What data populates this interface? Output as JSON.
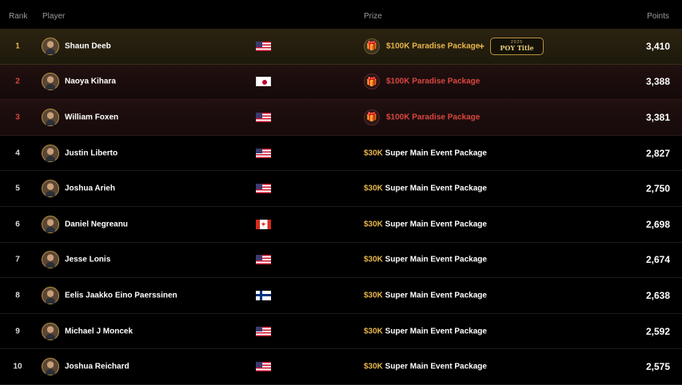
{
  "header": {
    "rank": "Rank",
    "player": "Player",
    "prize": "Prize",
    "points": "Points"
  },
  "poy_badge": {
    "year": "2025",
    "title": "POY Title",
    "plus": "+"
  },
  "rows": [
    {
      "rank": "1",
      "name": "Shaun Deeb",
      "flag": "us",
      "prize": "$100K Paradise Package",
      "points": "3,410"
    },
    {
      "rank": "2",
      "name": "Naoya Kihara",
      "flag": "jp",
      "prize": "$100K Paradise Package",
      "points": "3,388"
    },
    {
      "rank": "3",
      "name": "William Foxen",
      "flag": "us",
      "prize": "$100K Paradise Package",
      "points": "3,381"
    },
    {
      "rank": "4",
      "name": "Justin Liberto",
      "flag": "us",
      "prize_amount": "$30K",
      "prize_rest": " Super Main Event Package",
      "points": "2,827"
    },
    {
      "rank": "5",
      "name": "Joshua Arieh",
      "flag": "us",
      "prize_amount": "$30K",
      "prize_rest": " Super Main Event Package",
      "points": "2,750"
    },
    {
      "rank": "6",
      "name": "Daniel Negreanu",
      "flag": "ca",
      "prize_amount": "$30K",
      "prize_rest": " Super Main Event Package",
      "points": "2,698"
    },
    {
      "rank": "7",
      "name": "Jesse Lonis",
      "flag": "us",
      "prize_amount": "$30K",
      "prize_rest": " Super Main Event Package",
      "points": "2,674"
    },
    {
      "rank": "8",
      "name": "Eelis Jaakko Eino Paerssinen",
      "flag": "fi",
      "prize_amount": "$30K",
      "prize_rest": " Super Main Event Package",
      "points": "2,638"
    },
    {
      "rank": "9",
      "name": "Michael J Moncek",
      "flag": "us",
      "prize_amount": "$30K",
      "prize_rest": " Super Main Event Package",
      "points": "2,592"
    },
    {
      "rank": "10",
      "name": "Joshua Reichard",
      "flag": "us",
      "prize_amount": "$30K",
      "prize_rest": " Super Main Event Package",
      "points": "2,575"
    }
  ],
  "colors": {
    "gold": "#e6b54a",
    "red": "#d9473f",
    "background": "#000000"
  }
}
